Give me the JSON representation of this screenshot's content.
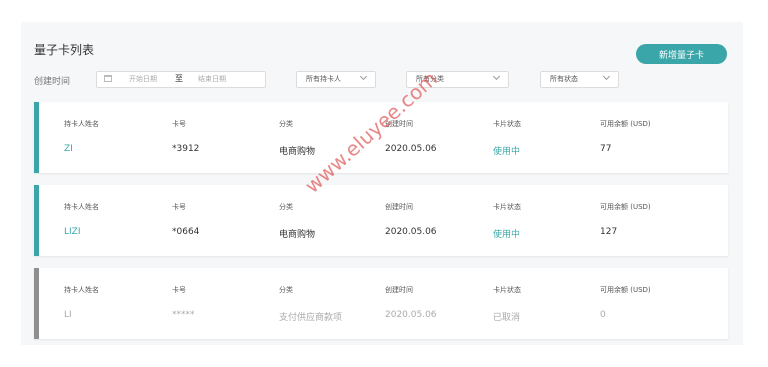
{
  "page_title": "量子卡列表",
  "new_button_label": "新增量子卡",
  "filters": {
    "date_label": "创建时间",
    "date_start_placeholder": "开始日期",
    "date_separator": "至",
    "date_end_placeholder": "结束日期",
    "holder_select": "所有持卡人",
    "category_select": "所有分类",
    "status_select": "所有状态"
  },
  "columns": [
    "持卡人姓名",
    "卡号",
    "分类",
    "创建时间",
    "卡片状态",
    "可用余额 (USD)"
  ],
  "cards": [
    {
      "holder": "ZI",
      "card_no": "*3912",
      "category": "电商购物",
      "created": "2020.05.06",
      "status": "使用中",
      "balance": "77",
      "accent": "#3aa6a9",
      "active": true
    },
    {
      "holder": "LIZI",
      "card_no": "*0664",
      "category": "电商购物",
      "created": "2020.05.06",
      "status": "使用中",
      "balance": "127",
      "accent": "#3aa6a9",
      "active": true
    },
    {
      "holder": "LI",
      "card_no": "*****",
      "category": "支付供应商款项",
      "created": "2020.05.06",
      "status": "已取消",
      "balance": "0",
      "accent": "#8f8f8f",
      "active": false
    }
  ],
  "watermark": "www.eluyee.com",
  "colors": {
    "accent": "#3aa6a9",
    "inactive_bar": "#8f8f8f",
    "inactive_text": "#aaaaaa"
  }
}
